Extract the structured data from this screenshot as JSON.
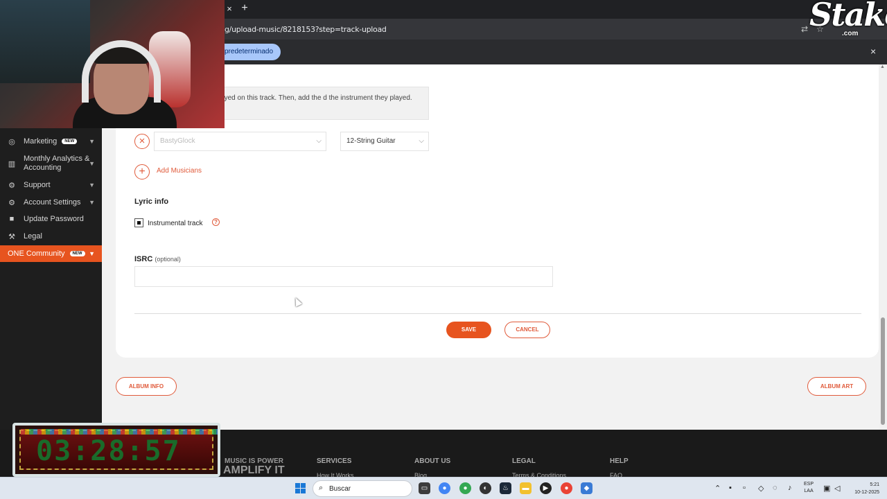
{
  "browser": {
    "url": "g/upload-music/8218153?step=track-upload",
    "infobar_pill": "predeterminado",
    "close_glyph": "×",
    "new_tab_glyph": "+"
  },
  "sidebar": {
    "items": [
      {
        "label": "Marketing",
        "icon": "megaphone-icon",
        "badge": "NEW",
        "chevron": true
      },
      {
        "label": "Monthly Analytics & Accounting",
        "icon": "chart-icon",
        "chevron": true
      },
      {
        "label": "Support",
        "icon": "gear-icon",
        "chevron": true
      },
      {
        "label": "Account Settings",
        "icon": "settings-icon",
        "chevron": true
      },
      {
        "label": "Update Password",
        "icon": "lock-icon"
      },
      {
        "label": "Legal",
        "icon": "gavel-icon"
      },
      {
        "label": "ONE Community",
        "icon": "",
        "badge": "NEW",
        "chevron": true,
        "active": true
      }
    ]
  },
  "form": {
    "note_text": "o credit musicians that played on this track. Then, add the d the instrument they played.",
    "musician": {
      "name": "BastyGlock",
      "instrument": "12-String Guitar"
    },
    "add_musicians": "Add Musicians",
    "lyric_heading": "Lyric info",
    "instrumental_label": "Instrumental track",
    "instrumental_checked": true,
    "isrc_label": "ISRC",
    "isrc_optional": "(optional)",
    "isrc_value": "",
    "save": "SAVE",
    "cancel": "CANCEL"
  },
  "nav_buttons": {
    "prev": "ALBUM INFO",
    "next": "ALBUM ART"
  },
  "footer": {
    "brand_line1": "MUSIC IS POWER",
    "brand_line2": "AMPLIFY IT",
    "columns": [
      {
        "title": "SERVICES",
        "link": "How It Works"
      },
      {
        "title": "ABOUT US",
        "link": "Blog"
      },
      {
        "title": "LEGAL",
        "link": "Terms & Conditions"
      },
      {
        "title": "HELP",
        "link": "FAQ"
      }
    ]
  },
  "taskbar": {
    "search_placeholder": "Buscar",
    "lang_line1": "ESP",
    "lang_line2": "LAA",
    "time": "5:21",
    "date": "10-12-2025"
  },
  "overlays": {
    "stake_logo": "Stake",
    "stake_domain": ".com",
    "timer": "03:28:57"
  },
  "colors": {
    "accent": "#e7541f",
    "sidebar_bg": "#1e1e1e",
    "page_bg": "#f2f2f2"
  }
}
